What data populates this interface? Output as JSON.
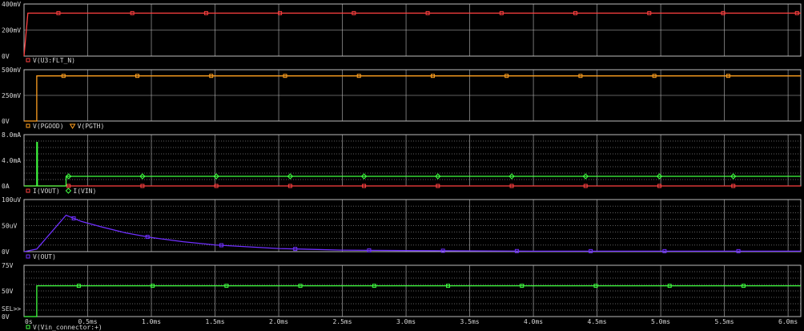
{
  "chart_data": [
    {
      "type": "line",
      "y_ticks": [
        "400mV",
        "200mV",
        "0V"
      ],
      "ylim": [
        0,
        400
      ],
      "grid": "solid",
      "legend": [
        {
          "marker": "square",
          "color": "#ff4040",
          "label": "V(U3:FLT_N)"
        }
      ],
      "series": [
        {
          "name": "V(U3:FLT_N)",
          "color": "#ff4040",
          "marker": "square",
          "x": [
            0,
            0.03,
            6.1
          ],
          "y": [
            0,
            330,
            330
          ]
        }
      ]
    },
    {
      "type": "line",
      "y_ticks": [
        "500mV",
        "250mV",
        "0V"
      ],
      "ylim": [
        0,
        500
      ],
      "grid": "solid",
      "legend": [
        {
          "marker": "square",
          "color": "#ffa020",
          "label": "V(PGOOD)"
        },
        {
          "marker": "triangle",
          "color": "#ffa020",
          "label": "V(PGTH)"
        }
      ],
      "series": [
        {
          "name": "V(PGOOD)",
          "color": "#ffa020",
          "marker": "square",
          "x": [
            0,
            0.1,
            0.1,
            6.1
          ],
          "y": [
            0,
            0,
            440,
            440
          ]
        }
      ]
    },
    {
      "type": "line",
      "y_ticks": [
        "8.0mA",
        "4.0mA",
        "0A"
      ],
      "ylim": [
        0,
        8
      ],
      "grid": "dotted",
      "legend": [
        {
          "marker": "square",
          "color": "#ff4040",
          "label": "I(VOUT)"
        },
        {
          "marker": "diamond",
          "color": "#40ff40",
          "label": "I(VIN)"
        }
      ],
      "series": [
        {
          "name": "I(VOUT)",
          "color": "#ff4040",
          "marker": "square",
          "x": [
            0,
            6.1
          ],
          "y": [
            0,
            0
          ]
        },
        {
          "name": "I(VIN)",
          "color": "#40ff40",
          "marker": "diamond",
          "x": [
            0,
            0.1,
            0.1,
            0.105,
            0.105,
            0.33,
            0.33,
            6.1
          ],
          "y": [
            0,
            0,
            6.8,
            6.8,
            0,
            0,
            1.5,
            1.5
          ]
        }
      ]
    },
    {
      "type": "line",
      "y_ticks": [
        "100uV",
        "50uV",
        "0V"
      ],
      "ylim": [
        0,
        100
      ],
      "grid": "dotted",
      "legend": [
        {
          "marker": "square",
          "color": "#7030ff",
          "label": "V(OUT)"
        }
      ],
      "series": [
        {
          "name": "V(OUT)",
          "color": "#7030ff",
          "marker": "square",
          "x": [
            0,
            0.1,
            0.33,
            0.45,
            0.6,
            0.8,
            1.0,
            1.25,
            1.5,
            2.0,
            2.5,
            3.0,
            4.0,
            5.0,
            6.1
          ],
          "y": [
            0,
            5,
            70,
            58,
            48,
            36,
            27,
            19,
            13,
            6,
            3,
            2,
            1,
            1,
            1
          ]
        }
      ]
    },
    {
      "type": "line",
      "y_ticks": [
        "75V",
        "50V",
        "0V"
      ],
      "ylim": [
        0,
        100
      ],
      "grid": "dotted",
      "sel_label": "SEL>>",
      "legend": [
        {
          "marker": "square",
          "color": "#40ff40",
          "label": "V(Vin_connector:+)"
        }
      ],
      "series": [
        {
          "name": "V(Vin_connector:+)",
          "color": "#40ff40",
          "marker": "square",
          "x": [
            0,
            0.1,
            0.1,
            6.1
          ],
          "y": [
            0,
            0,
            60,
            60
          ]
        }
      ]
    }
  ],
  "x_axis": {
    "ticks": [
      "0s",
      "0.5ms",
      "1.0ms",
      "1.5ms",
      "2.0ms",
      "2.5ms",
      "3.0ms",
      "3.5ms",
      "4.0ms",
      "4.5ms",
      "5.0ms",
      "5.5ms",
      "6.0ms"
    ],
    "tick_values": [
      0,
      0.5,
      1.0,
      1.5,
      2.0,
      2.5,
      3.0,
      3.5,
      4.0,
      4.5,
      5.0,
      5.5,
      6.0
    ],
    "xlim": [
      0,
      6.1
    ]
  },
  "colors": {
    "background": "#000000",
    "grid": "#bdbdbd",
    "axis_text": "#d8d8d8"
  }
}
